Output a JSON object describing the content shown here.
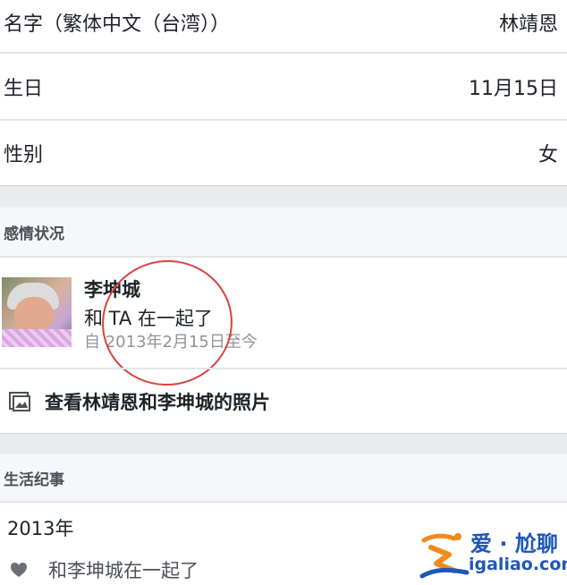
{
  "profile_fields": [
    {
      "label": "名字（繁体中文（台湾））",
      "value": "林靖恩"
    },
    {
      "label": "生日",
      "value": "11月15日"
    },
    {
      "label": "性别",
      "value": "女"
    }
  ],
  "relationship": {
    "section_title": "感情状况",
    "partner_name": "李坤城",
    "status": "和 TA 在一起了",
    "since": "自 2013年2月15日至今",
    "photos_link": "查看林靖恩和李坤城的照片"
  },
  "life_events": {
    "section_title": "生活纪事",
    "year": "2013年",
    "event": "和李坤城在一起了"
  },
  "watermark": {
    "title": "爱 · 尬聊",
    "url": "igaliao.com"
  },
  "colors": {
    "annotation_circle": "#d9443a",
    "watermark_blue": "#1e57b8",
    "watermark_orange": "#f08a1c"
  }
}
